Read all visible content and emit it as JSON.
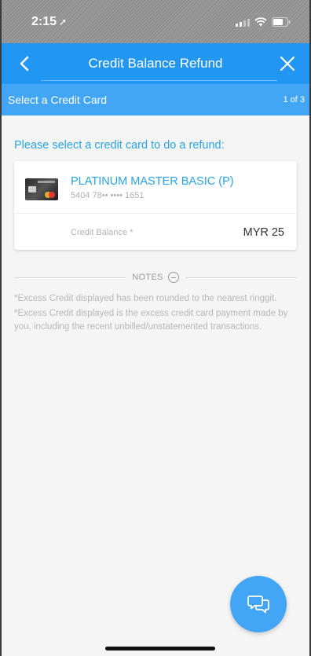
{
  "status_bar": {
    "time": "2:15",
    "location_glyph": "➚"
  },
  "nav": {
    "title": "Credit Balance Refund",
    "back_icon": "chevron-left-icon",
    "close_icon": "close-icon"
  },
  "step": {
    "title": "Select a Credit Card",
    "count": "1 of 3"
  },
  "prompt": "Please select a credit card to do a refund:",
  "card": {
    "name": "PLATINUM MASTER BASIC (P)",
    "number": "5404 78•• •••• 1651",
    "balance_label": "Credit Balance *",
    "balance_value": "MYR 25"
  },
  "notes": {
    "label": "NOTES",
    "items": [
      "*Excess Credit displayed has been rounded to the nearest ringgit.",
      "*Excess Credit displayed is the excess credit card payment made by you, including the recent unbilled/unstatemented transactions."
    ]
  },
  "colors": {
    "primary": "#2196f3",
    "step_bar": "#42a5f5",
    "link": "#29a3e8"
  }
}
